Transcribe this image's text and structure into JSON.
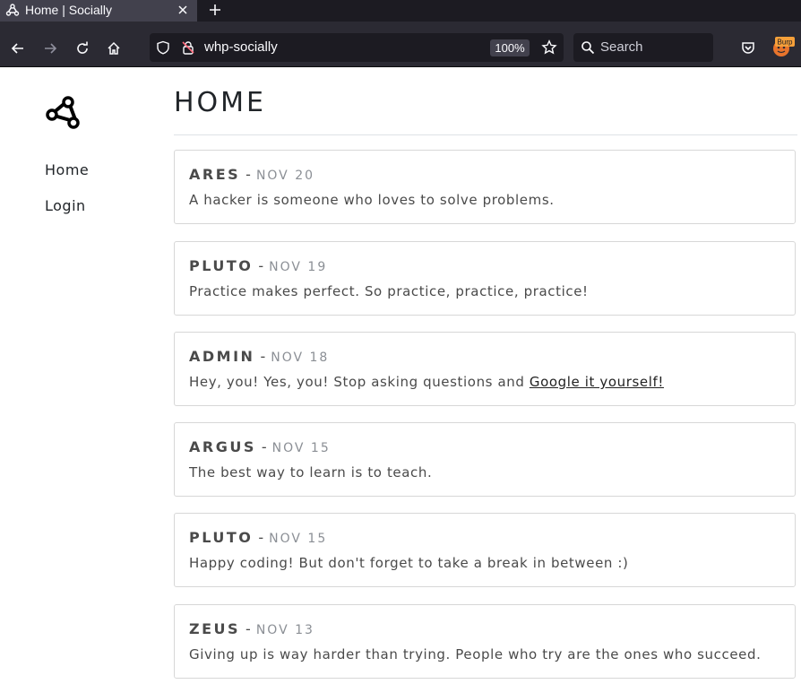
{
  "browser": {
    "tab_title": "Home | Socially",
    "url": "whp-socially",
    "zoom": "100%",
    "search_placeholder": "Search",
    "burp_label": "Burp"
  },
  "sidebar": {
    "items": [
      {
        "label": "Home"
      },
      {
        "label": "Login"
      }
    ]
  },
  "main": {
    "title": "HOME",
    "posts": [
      {
        "author": "ARES",
        "date": "NOV 20",
        "text": "A hacker is someone who loves to solve problems."
      },
      {
        "author": "PLUTO",
        "date": "NOV 19",
        "text": "Practice makes perfect. So practice, practice, practice!"
      },
      {
        "author": "ADMIN",
        "date": "NOV 18",
        "text": "Hey, you! Yes, you! Stop asking questions and ",
        "link": "Google it yourself!"
      },
      {
        "author": "ARGUS",
        "date": "NOV 15",
        "text": "The best way to learn is to teach."
      },
      {
        "author": "PLUTO",
        "date": "NOV 15",
        "text": "Happy coding! But don't forget to take a break in between :)"
      },
      {
        "author": "ZEUS",
        "date": "NOV 13",
        "text": "Giving up is way harder than trying. People who try are the ones who succeed."
      }
    ]
  },
  "separator": "-",
  "colors": {
    "chrome_dark": "#1c1b22",
    "chrome_mid": "#2b2a33",
    "text": "#4a4a4a",
    "date": "#8b8f95",
    "border": "#d7d7d7"
  }
}
